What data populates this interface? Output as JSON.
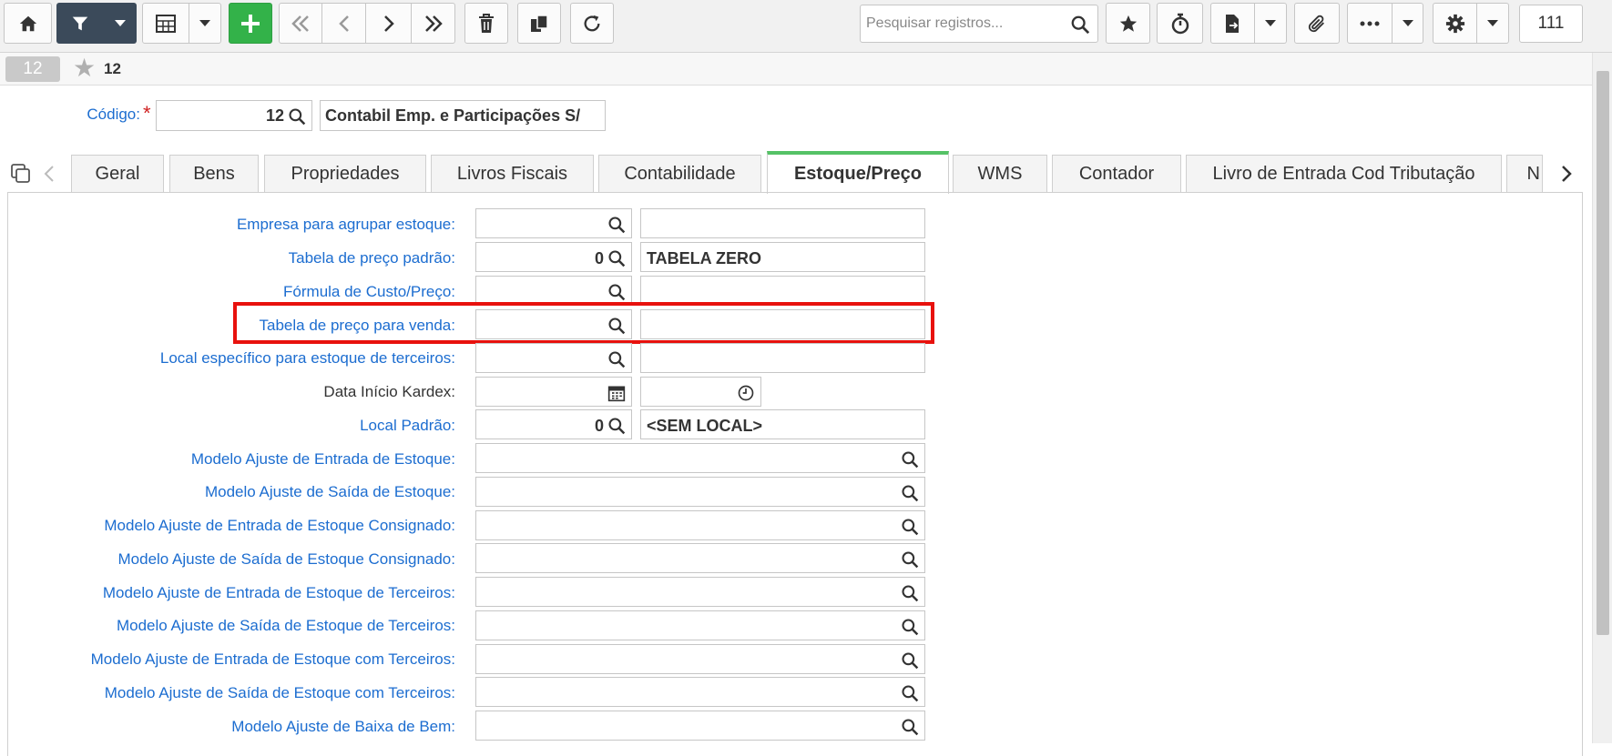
{
  "toolbar": {
    "search_placeholder": "Pesquisar registros...",
    "record_counter": "111",
    "icons": [
      "home-icon",
      "filter-icon",
      "caret-down-icon",
      "grid-icon",
      "caret-down-icon",
      "plus-icon",
      "first-icon",
      "prev-icon",
      "next-icon",
      "last-icon",
      "trash-icon",
      "copy-icon",
      "refresh-icon",
      "search-icon",
      "star-icon",
      "stopwatch-icon",
      "export-icon",
      "caret-down-icon",
      "paperclip-icon",
      "more-icon",
      "caret-down-icon",
      "gear-icon",
      "caret-down-icon"
    ]
  },
  "record": {
    "badge": "12",
    "title": "12"
  },
  "header": {
    "codigo_label": "Código:",
    "codigo_value": "12",
    "company_name": "Contabil Emp. e Participações S/"
  },
  "tabs": [
    {
      "label": "Geral"
    },
    {
      "label": "Bens"
    },
    {
      "label": "Propriedades"
    },
    {
      "label": "Livros Fiscais"
    },
    {
      "label": "Contabilidade"
    },
    {
      "label": "Estoque/Preço",
      "active": true
    },
    {
      "label": "WMS"
    },
    {
      "label": "Contador"
    },
    {
      "label": "Livro de Entrada Cod Tributação"
    },
    {
      "label": "N"
    }
  ],
  "form": {
    "empresa_agrupar": {
      "label": "Empresa para agrupar estoque:",
      "code": "",
      "desc": ""
    },
    "tabela_padrao": {
      "label": "Tabela de preço padrão:",
      "code": "0",
      "desc": "TABELA ZERO"
    },
    "formula_custo": {
      "label": "Fórmula de Custo/Preço:",
      "code": "",
      "desc": ""
    },
    "tabela_venda": {
      "label": "Tabela de preço para venda:",
      "code": "",
      "desc": ""
    },
    "local_terceiros": {
      "label": "Local específico para estoque de terceiros:",
      "code": "",
      "desc": ""
    },
    "data_kardex": {
      "label": "Data Início Kardex:",
      "date": "",
      "time": ""
    },
    "local_padrao": {
      "label": "Local Padrão:",
      "code": "0",
      "desc": "<SEM LOCAL>"
    },
    "modelos": [
      {
        "label": "Modelo Ajuste de Entrada de Estoque:",
        "value": ""
      },
      {
        "label": "Modelo Ajuste de Saída de Estoque:",
        "value": ""
      },
      {
        "label": "Modelo Ajuste de Entrada de Estoque Consignado:",
        "value": ""
      },
      {
        "label": "Modelo Ajuste de Saída de Estoque Consignado:",
        "value": ""
      },
      {
        "label": "Modelo Ajuste de Entrada de Estoque de Terceiros:",
        "value": ""
      },
      {
        "label": "Modelo Ajuste de Saída de Estoque de Terceiros:",
        "value": ""
      },
      {
        "label": "Modelo Ajuste de Entrada de Estoque com Terceiros:",
        "value": ""
      },
      {
        "label": "Modelo Ajuste de Saída de Estoque com Terceiros:",
        "value": ""
      },
      {
        "label": "Modelo Ajuste de Baixa de Bem:",
        "value": ""
      }
    ]
  },
  "colors": {
    "label_blue": "#1c6dd0",
    "highlight": "#e8110d",
    "active_tab": "#55c266",
    "add_button": "#33b249"
  }
}
